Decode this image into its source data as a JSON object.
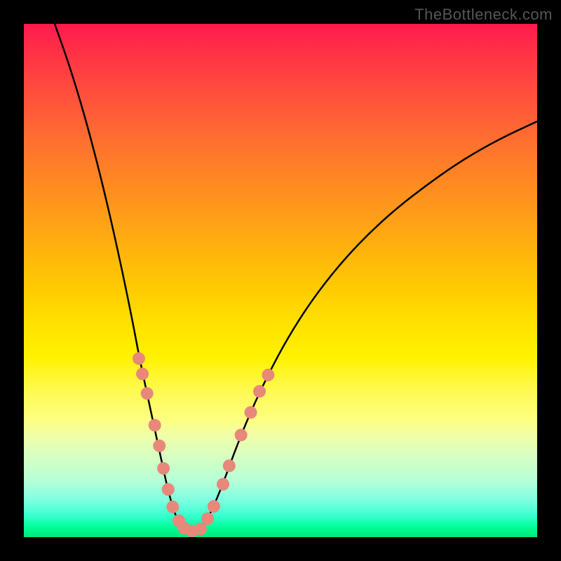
{
  "watermark": "TheBottleneck.com",
  "chart_data": {
    "type": "line",
    "title": "",
    "xlabel": "",
    "ylabel": "",
    "xlim": [
      0,
      1
    ],
    "ylim": [
      0,
      1
    ],
    "background": {
      "type": "gradient",
      "colors": [
        "#ff1a4d",
        "#ff6633",
        "#ffcc00",
        "#fff94d",
        "#00ff99"
      ]
    },
    "series": [
      {
        "name": "left-curve",
        "type": "line",
        "color": "#000000",
        "points": [
          {
            "x": 0.06,
            "y": 1.0
          },
          {
            "x": 0.085,
            "y": 0.93
          },
          {
            "x": 0.11,
            "y": 0.85
          },
          {
            "x": 0.135,
            "y": 0.76
          },
          {
            "x": 0.16,
            "y": 0.66
          },
          {
            "x": 0.185,
            "y": 0.55
          },
          {
            "x": 0.21,
            "y": 0.43
          },
          {
            "x": 0.225,
            "y": 0.35
          },
          {
            "x": 0.24,
            "y": 0.28
          },
          {
            "x": 0.255,
            "y": 0.21
          },
          {
            "x": 0.268,
            "y": 0.15
          },
          {
            "x": 0.28,
            "y": 0.095
          },
          {
            "x": 0.292,
            "y": 0.052
          },
          {
            "x": 0.302,
            "y": 0.028
          },
          {
            "x": 0.31,
            "y": 0.015
          },
          {
            "x": 0.32,
            "y": 0.008
          },
          {
            "x": 0.328,
            "y": 0.005
          }
        ]
      },
      {
        "name": "right-curve",
        "type": "line",
        "color": "#000000",
        "points": [
          {
            "x": 0.328,
            "y": 0.005
          },
          {
            "x": 0.34,
            "y": 0.01
          },
          {
            "x": 0.355,
            "y": 0.03
          },
          {
            "x": 0.372,
            "y": 0.065
          },
          {
            "x": 0.39,
            "y": 0.11
          },
          {
            "x": 0.412,
            "y": 0.17
          },
          {
            "x": 0.44,
            "y": 0.24
          },
          {
            "x": 0.475,
            "y": 0.315
          },
          {
            "x": 0.515,
            "y": 0.39
          },
          {
            "x": 0.56,
            "y": 0.46
          },
          {
            "x": 0.61,
            "y": 0.525
          },
          {
            "x": 0.665,
            "y": 0.585
          },
          {
            "x": 0.725,
            "y": 0.64
          },
          {
            "x": 0.79,
            "y": 0.69
          },
          {
            "x": 0.855,
            "y": 0.735
          },
          {
            "x": 0.925,
            "y": 0.775
          },
          {
            "x": 1.0,
            "y": 0.81
          }
        ]
      },
      {
        "name": "highlight-dots",
        "type": "scatter",
        "color": "#e8887a",
        "radius": 9,
        "points": [
          {
            "x": 0.224,
            "y": 0.348
          },
          {
            "x": 0.231,
            "y": 0.318
          },
          {
            "x": 0.24,
            "y": 0.28
          },
          {
            "x": 0.255,
            "y": 0.218
          },
          {
            "x": 0.264,
            "y": 0.178
          },
          {
            "x": 0.272,
            "y": 0.134
          },
          {
            "x": 0.281,
            "y": 0.093
          },
          {
            "x": 0.29,
            "y": 0.059
          },
          {
            "x": 0.302,
            "y": 0.032
          },
          {
            "x": 0.312,
            "y": 0.018
          },
          {
            "x": 0.327,
            "y": 0.012
          },
          {
            "x": 0.344,
            "y": 0.016
          },
          {
            "x": 0.358,
            "y": 0.036
          },
          {
            "x": 0.37,
            "y": 0.06
          },
          {
            "x": 0.388,
            "y": 0.103
          },
          {
            "x": 0.4,
            "y": 0.139
          },
          {
            "x": 0.423,
            "y": 0.199
          },
          {
            "x": 0.442,
            "y": 0.243
          },
          {
            "x": 0.459,
            "y": 0.284
          },
          {
            "x": 0.476,
            "y": 0.316
          }
        ]
      }
    ]
  }
}
